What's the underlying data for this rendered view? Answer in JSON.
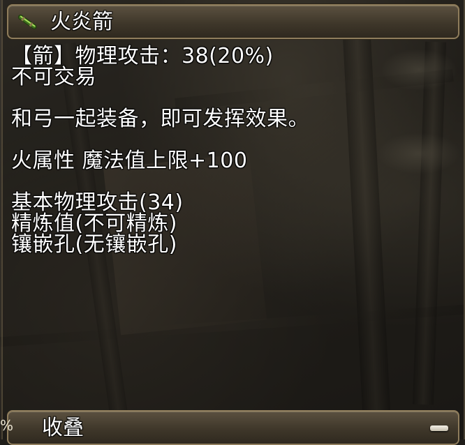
{
  "item": {
    "name": "火炎箭",
    "icon": "green-arrow-icon"
  },
  "description": {
    "line1": "【箭】物理攻击：38(20%)",
    "line2": "不可交易",
    "line3": "和弓一起装备，即可发挥效果。",
    "line4": "火属性 魔法值上限+100",
    "line5": "基本物理攻击(34)",
    "line6": "精炼值(不可精炼)",
    "line7": "镶嵌孔(无镶嵌孔)"
  },
  "footer": {
    "collapse_label": "收叠",
    "collapse_icon": "minus-icon",
    "edge_glyph": "%"
  },
  "colors": {
    "text": "#ffffff",
    "frame": "#8f7d5c",
    "bar": "#4a4134"
  }
}
